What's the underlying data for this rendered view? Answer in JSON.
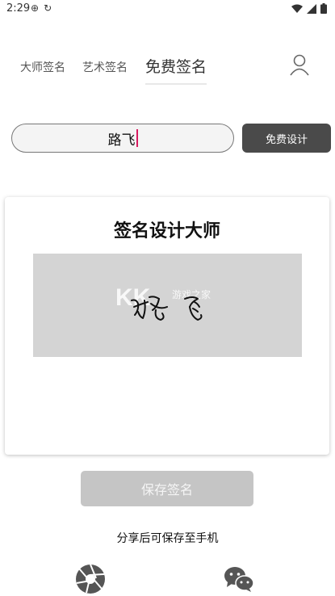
{
  "status_bar": {
    "time": "2:29"
  },
  "tabs": {
    "master": "大师签名",
    "art": "艺术签名",
    "free": "免费签名"
  },
  "input": {
    "value": "路飞"
  },
  "design_button_label": "免费设计",
  "card": {
    "title": "签名设计大师",
    "watermark": "KK游戏之家",
    "signature_text": "路飞"
  },
  "save_button_label": "保存签名",
  "share_hint": "分享后可保存至手机",
  "colors": {
    "dark_button": "#4a4a4a",
    "disabled_button": "#c5c5c5",
    "caret": "#d81b60",
    "signature_bg": "#d4d4d4"
  },
  "icons": [
    "user-icon",
    "aperture-icon",
    "wechat-icon",
    "wifi-icon",
    "signal-icon",
    "battery-icon"
  ]
}
